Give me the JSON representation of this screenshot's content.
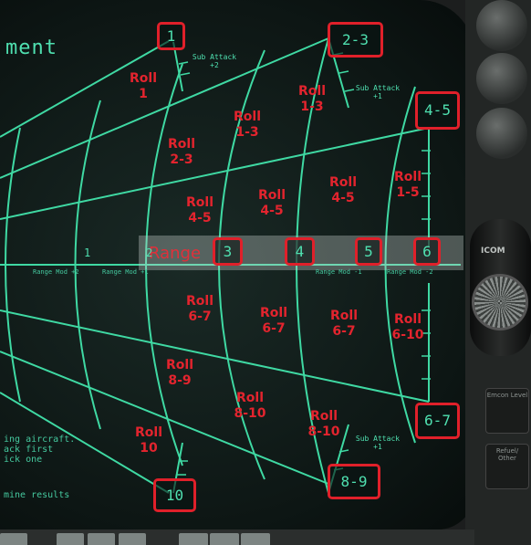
{
  "screen": {
    "title": "ment",
    "help_lines": [
      "ing aircraft.",
      "ack first",
      "ick one"
    ],
    "help_footer": "mine results"
  },
  "range": {
    "label": "Range",
    "markers": [
      "3",
      "4",
      "5",
      "6"
    ],
    "axis_labels": [
      "1",
      "2"
    ],
    "mods": [
      "Range Mod +2",
      "Range Mod +1",
      "Range Mod -1",
      "Range Mod -2"
    ]
  },
  "bearing_boxes": [
    "1",
    "2-3",
    "4-5",
    "6-7",
    "8-9",
    "10"
  ],
  "sub_attack": [
    {
      "line1": "Sub Attack",
      "line2": "+2"
    },
    {
      "line1": "Sub Attack",
      "line2": "+1"
    },
    {
      "line1": "Sub Attack",
      "line2": "+1"
    }
  ],
  "roll_cells": [
    {
      "label": "Roll",
      "value": "1"
    },
    {
      "label": "Roll",
      "value": "1-3"
    },
    {
      "label": "Roll",
      "value": "1-3"
    },
    {
      "label": "Roll",
      "value": "2-3"
    },
    {
      "label": "Roll",
      "value": "1-5"
    },
    {
      "label": "Roll",
      "value": "4-5"
    },
    {
      "label": "Roll",
      "value": "4-5"
    },
    {
      "label": "Roll",
      "value": "4-5"
    },
    {
      "label": "Roll",
      "value": "6-7"
    },
    {
      "label": "Roll",
      "value": "6-7"
    },
    {
      "label": "Roll",
      "value": "6-7"
    },
    {
      "label": "Roll",
      "value": "6-10"
    },
    {
      "label": "Roll",
      "value": "8-9"
    },
    {
      "label": "Roll",
      "value": "8-10"
    },
    {
      "label": "Roll",
      "value": "8-10"
    },
    {
      "label": "Roll",
      "value": "10"
    }
  ],
  "panel": {
    "mic_label": "ICOM",
    "emcon_label": "Emcon Level",
    "refuel_label": "Refuel/ Other"
  },
  "colors": {
    "scope_line": "#3fd9a3",
    "highlight": "#e0202a",
    "roll_text": "#e3242e"
  }
}
